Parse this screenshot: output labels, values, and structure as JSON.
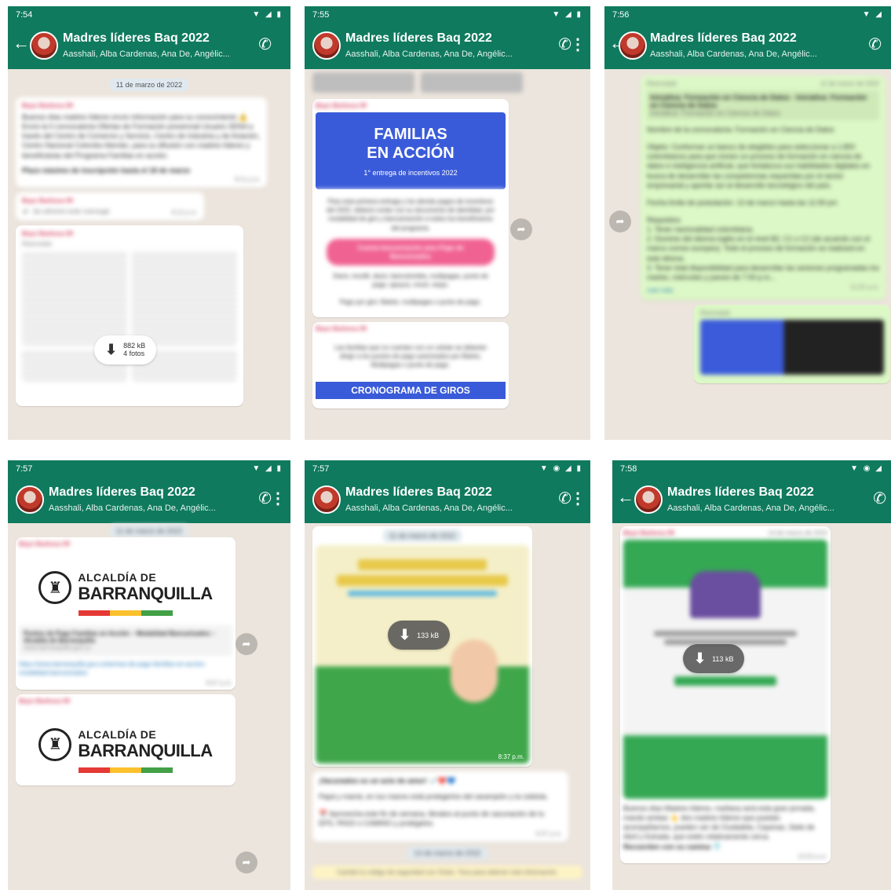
{
  "chat": {
    "title": "Madres líderes Baq 2022",
    "subtitle": "Aasshali, Alba Cardenas, Ana De, Angélic..."
  },
  "colors": {
    "header": "#0f7a5e",
    "wallpaper": "#ece5dd",
    "sender": "#d63b5a",
    "outgoing": "#dcf8c6"
  },
  "panels": [
    {
      "time": "7:54",
      "date_chip": "11 de marzo de 2022",
      "messages": [
        {
          "sender": "Bayo Barbosa 09",
          "text": "Buenos días madres líderes envío información para su conocimiento ⚠️ Envío la II convocatoria Ofertas de Formación presencial Usuario SENA a través del Centro de Comercio y Servicio, Centro de Industria y de Aviación, Centro Nacional Colombo Alemán, para su difusión con madres líderes y beneficiarias del Programa Familias en acción.",
          "bold": "Plazo máximo de inscripción hasta el 18 de marzo",
          "time": "8:11 p.m."
        },
        {
          "sender": "Bayo Barbosa 09",
          "deleted": "Se eliminó este mensaje",
          "time": "8:12 p.m."
        },
        {
          "sender": "Bayo Barbosa 09",
          "forwarded": "Reenviado",
          "download": "882 kB",
          "download_sub": "4 fotos"
        }
      ]
    },
    {
      "time": "7:55",
      "fa": {
        "title_1": "FAMILIAS",
        "title_2": "EN ACCIÓN",
        "sub": "1° entrega de incentivos 2022",
        "body": "Para esta primera entrega y los demás pagos de incentivos del 2022, deberá contar con su documento de identidad, por modalidad de giro y bancarización a todos los beneficiarios del programa.",
        "pill": "Cuenta bancarización para Pago de Bancarizados",
        "body_2": "Daviv, movilk, daviv, bancolombia, multipagas, punto de pago, apoyos, movii, nequi.",
        "foot": "Pago por giro: Baloto, multipagas o punto de pago."
      },
      "second": {
        "sender": "Bayo Barbosa 09",
        "body": "Las familias que no cuentan con un celular se deberán dirigir a los puntos de pago autorizados por Baloto, Multipagas o punto de pago.",
        "strip": "CRONOGRAMA DE GIROS"
      }
    },
    {
      "time": "7:56",
      "date_chip": "11 de marzo de 2022",
      "forwarded": "Reenviado",
      "link_title": "Iniciativa: Formación en Ciencia de Datos - Iniciativa: Formación en Ciencia de Datos",
      "link_sub": "Iniciativa: Formación en Ciencia de Datos",
      "intro": "Nombre de la convocatoria: Formación en Ciencia de Datos",
      "objective": "Objeto: Conformar un banco de elegibles para seleccionar a 1.800 colombianos para que inicien un proceso de formación en ciencia de datos e inteligencia artificial, que fortalezca sus habilidades digitales en busca de desarrollar las competencias requeridas por el sector empresarial y aportar así al desarrollo tecnológico del país.",
      "deadline": "Fecha límite de postulación: 13 de marzo hasta las 11:59 pm",
      "req_title": "Requisitos:",
      "req_1": "1. Tener nacionalidad colombiana.",
      "req_2": "2. Dominio del idioma inglés en el nivel B2, C1 o C2 (de acuerdo con el marco común europeo). Todo el proceso de formación se realizará en este idioma.",
      "req_3": "3. Tener total disponibilidad para desarrollar las sesiones programadas los martes, miércoles y jueves de 7:00 p.m...",
      "read_more": "Leer más",
      "time_stamp": "11:02 a.m.",
      "forwarded_2": "Reenviado"
    },
    {
      "time": "7:57",
      "date_chip": "11 de marzo de 2022",
      "sender": "Bayo Barbosa 09",
      "logo_small": "ALCALDÍA DE",
      "logo_big": "BARRANQUILLA",
      "link_title": "Puntos de Pago Familias en Acción – Modalidad Bancarizados – Alcaldía de Barranquilla",
      "link_domain": "www.barranquilla.gov.co",
      "link_url": "https://www.barranquilla.gov.co/tarmas-de-pago-familias-en-accion-modalidad-bancarizados",
      "time_stamp": "8:07 p.m.",
      "sender_2": "Bayo Barbosa 09",
      "bar_colors": [
        "#e53935",
        "#fbc02d",
        "#43a047"
      ]
    },
    {
      "time": "7:57",
      "date_chip": "11 de marzo de 2022",
      "download": "133 kB",
      "image_time": "8:37 p.m.",
      "caption": "¡Vacunados es un acto de amor! 💉❤️💙",
      "body": "Papá y mamá, en tus manos está protegerlos del sarampión y la rubéola.",
      "body_2": "📅 Aprovecha este fin de semana, llévalos al punto de vacunación de tu EPS, PASO o CAMINO y protégelos.",
      "time_stamp": "8:37 p.m.",
      "date_chip_2": "14 de marzo de 2022",
      "notice": "Cambió tu código de seguridad con Vivian. Toca para obtener más información."
    },
    {
      "time": "7:58",
      "date_chip": "14 de marzo de 2022",
      "sender": "Bayo Barbosa 09",
      "download": "113 kB",
      "body": "Buenos días Madres líderes, mañana será esta gran jornada, mando ambas 👆 dos madres líderes que puedan acompañarnos, pueden ser de Ciudadela, Cayenas, Siete de Abril y Estrada, que estén relativamente cerca.",
      "closing": "Recuerden con su camisa 👕",
      "time_stamp": "10:53 a.m."
    }
  ]
}
